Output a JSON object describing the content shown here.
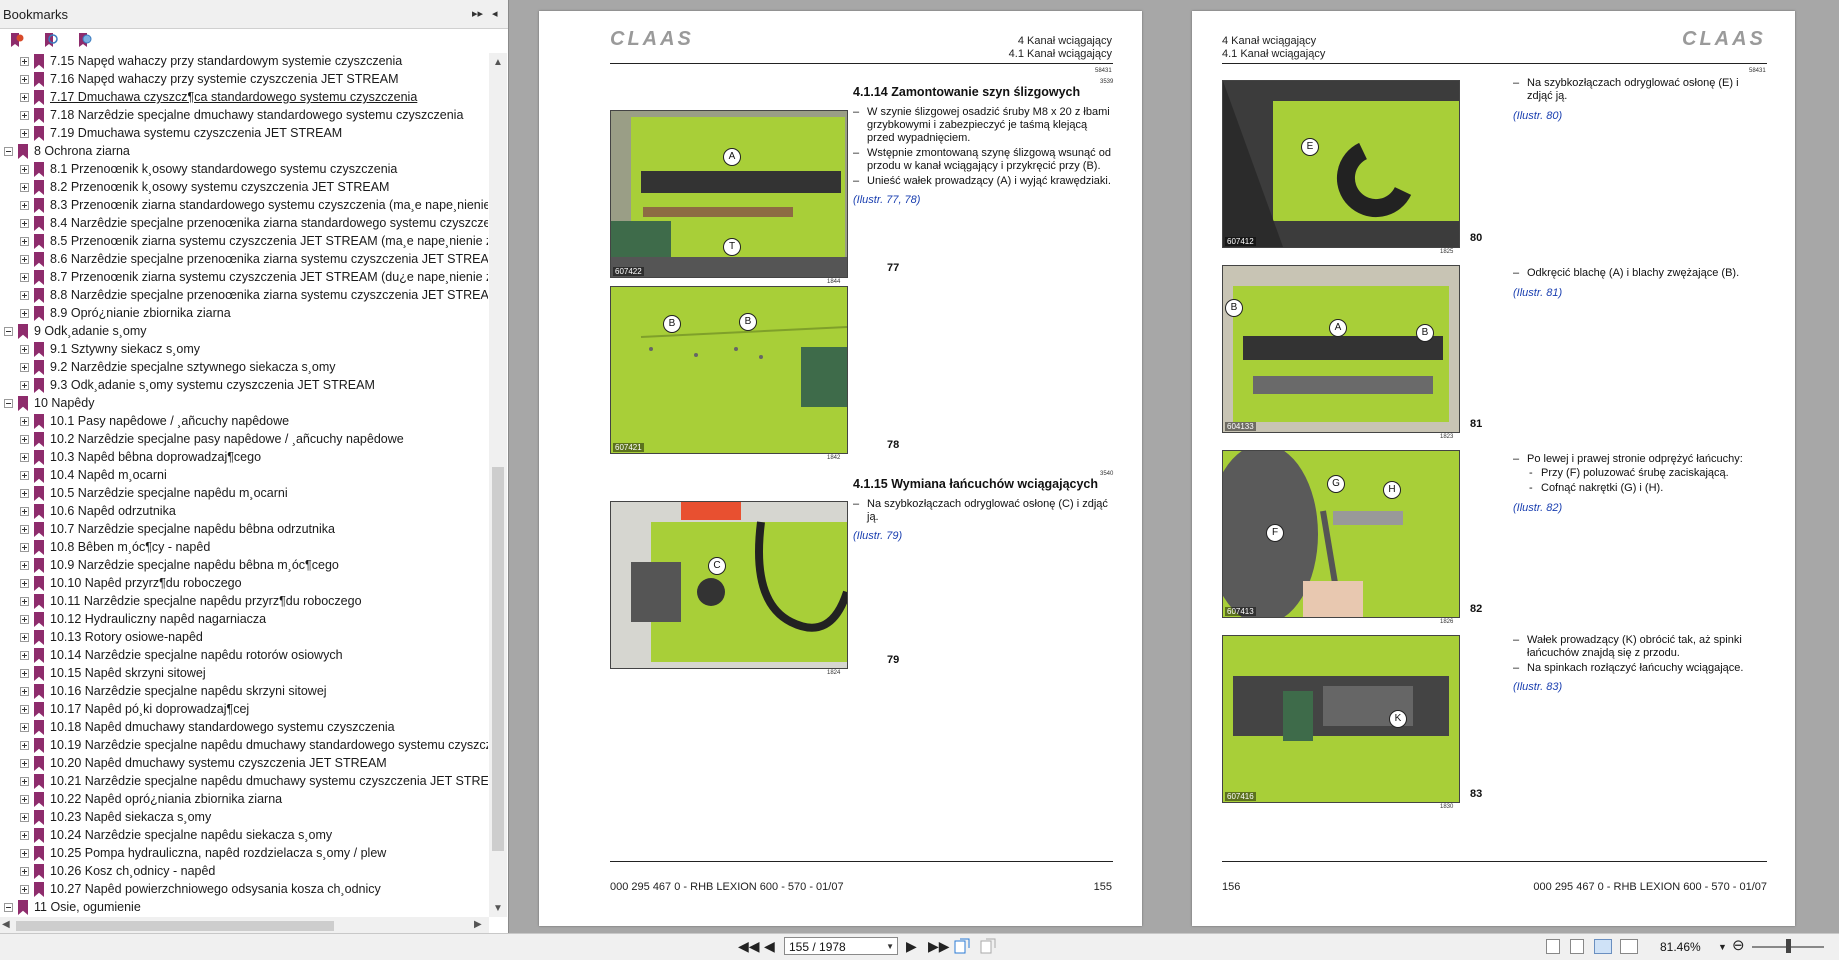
{
  "sidebar": {
    "title": "Bookmarks",
    "header_buttons": [
      "▸▸",
      "◂"
    ],
    "tools": [
      "bookmark-options-icon",
      "expand-bookmark-icon",
      "find-bookmark-icon"
    ],
    "items": [
      {
        "level": 1,
        "label": "7.15 Napęd wahaczy przy standardowym systemie czyszczenia"
      },
      {
        "level": 1,
        "label": "7.16 Napęd wahaczy przy systemie czyszczenia JET STREAM"
      },
      {
        "level": 1,
        "label": "7.17 Dmuchawa czyszcz¶ca standardowego systemu czyszczenia",
        "highlight": true
      },
      {
        "level": 1,
        "label": "7.18 Narzêdzie specjalne dmuchawy standardowego systemu czyszczenia"
      },
      {
        "level": 1,
        "label": "7.19 Dmuchawa systemu czyszczenia JET STREAM"
      },
      {
        "level": 0,
        "label": "8 Ochrona ziarna"
      },
      {
        "level": 1,
        "label": "8.1 Przenoœnik k¸osowy standardowego systemu czyszczenia"
      },
      {
        "level": 1,
        "label": "8.2 Przenoœnik k¸osowy systemu czyszczenia JET STREAM"
      },
      {
        "level": 1,
        "label": "8.3 Przenoœnik ziarna standardowego systemu czyszczenia (ma¸e nape¸nienie"
      },
      {
        "level": 1,
        "label": "8.4 Narzêdzie specjalne przenoœnika ziarna standardowego systemu czyszczen"
      },
      {
        "level": 1,
        "label": "8.5 Przenoœnik ziarna systemu czyszczenia JET STREAM (ma¸e nape¸nienie zb"
      },
      {
        "level": 1,
        "label": "8.6 Narzêdzie specjalne przenoœnika ziarna systemu czyszczenia JET STREAM ("
      },
      {
        "level": 1,
        "label": "8.7 Przenoœnik ziarna systemu czyszczenia JET STREAM (du¿e nape¸nienie zb"
      },
      {
        "level": 1,
        "label": "8.8 Narzêdzie specjalne przenoœnika ziarna systemu czyszczenia JET STREAM ("
      },
      {
        "level": 1,
        "label": "8.9 Opró¿nianie zbiornika ziarna"
      },
      {
        "level": 0,
        "label": "9 Odk¸adanie s¸omy"
      },
      {
        "level": 1,
        "label": "9.1 Sztywny siekacz s¸omy"
      },
      {
        "level": 1,
        "label": "9.2 Narzêdzie specjalne sztywnego siekacza s¸omy"
      },
      {
        "level": 1,
        "label": "9.3 Odk¸adanie s¸omy systemu czyszczenia JET STREAM"
      },
      {
        "level": 0,
        "label": "10 Napêdy"
      },
      {
        "level": 1,
        "label": "10.1 Pasy napêdowe / ¸añcuchy napêdowe"
      },
      {
        "level": 1,
        "label": "10.2 Narzêdzie specjalne pasy napêdowe / ¸añcuchy napêdowe"
      },
      {
        "level": 1,
        "label": "10.3 Napêd bêbna doprowadzaj¶cego"
      },
      {
        "level": 1,
        "label": "10.4 Napêd m¸ocarni"
      },
      {
        "level": 1,
        "label": "10.5 Narzêdzie specjalne napêdu m¸ocarni"
      },
      {
        "level": 1,
        "label": "10.6 Napêd odrzutnika"
      },
      {
        "level": 1,
        "label": "10.7 Narzêdzie specjalne napêdu bêbna odrzutnika"
      },
      {
        "level": 1,
        "label": "10.8 Bêben m¸óc¶cy - napêd"
      },
      {
        "level": 1,
        "label": "10.9 Narzêdzie specjalne napêdu bêbna m¸óc¶cego"
      },
      {
        "level": 1,
        "label": "10.10 Napêd przyrz¶du roboczego"
      },
      {
        "level": 1,
        "label": "10.11 Narzêdzie specjalne napêdu przyrz¶du roboczego"
      },
      {
        "level": 1,
        "label": "10.12 Hydrauliczny napêd nagarniacza"
      },
      {
        "level": 1,
        "label": "10.13 Rotory osiowe-napêd"
      },
      {
        "level": 1,
        "label": "10.14 Narzêdzie specjalne napêdu rotorów osiowych"
      },
      {
        "level": 1,
        "label": "10.15 Napêd skrzyni sitowej"
      },
      {
        "level": 1,
        "label": "10.16 Narzêdzie specjalne napêdu skrzyni sitowej"
      },
      {
        "level": 1,
        "label": "10.17 Napêd pó¸ki doprowadzaj¶cej"
      },
      {
        "level": 1,
        "label": "10.18 Napêd dmuchawy standardowego systemu czyszczenia"
      },
      {
        "level": 1,
        "label": "10.19 Narzêdzie specjalne napêdu dmuchawy standardowego systemu czyszcz"
      },
      {
        "level": 1,
        "label": "10.20 Napêd dmuchawy systemu czyszczenia JET STREAM"
      },
      {
        "level": 1,
        "label": "10.21 Narzêdzie specjalne napêdu dmuchawy systemu czyszczenia JET STREA"
      },
      {
        "level": 1,
        "label": "10.22 Napêd opró¿niania zbiornika ziarna"
      },
      {
        "level": 1,
        "label": "10.23 Napêd siekacza s¸omy"
      },
      {
        "level": 1,
        "label": "10.24 Narzêdzie specjalne napêdu siekacza s¸omy"
      },
      {
        "level": 1,
        "label": "10.25 Pompa hydrauliczna, napêd rozdzielacza s¸omy / plew"
      },
      {
        "level": 1,
        "label": "10.26 Kosz ch¸odnicy - napêd"
      },
      {
        "level": 1,
        "label": "10.27 Napêd powierzchniowego odsysania kosza ch¸odnicy"
      },
      {
        "level": 0,
        "label": "11 Osie, ogumienie"
      }
    ]
  },
  "left_page": {
    "logo": "CLAAS",
    "header_line1": "4 Kanał wciągający",
    "header_line2": "4.1 Kanał wciągający",
    "code_top": "58431",
    "section1": {
      "code": "3539",
      "title": "4.1.14 Zamontowanie szyn ślizgowych",
      "bullets": [
        "W szynie ślizgowej osadzić śruby M8 x 20 z łbami grzybkowymi i zabezpieczyć je taśmą klejącą przed wypadnięciem.",
        "Wstępnie zmontowaną szynę ślizgową wsunąć od przodu w kanał wciągający i przykręcić przy (B).",
        "Unieść wałek prowadzący (A) i wyjąć krawędziaki."
      ],
      "ref": "(Ilustr. 77, 78)"
    },
    "section2": {
      "code": "3540",
      "title": "4.1.15 Wymiana łańcuchów wciągających",
      "bullets": [
        "Na szybkozłączach odryglować osłonę (C) i zdjąć ją."
      ],
      "ref": "(Ilustr. 79)"
    },
    "figures": [
      {
        "num": "77",
        "id": "607422",
        "small": "1844",
        "callouts": [
          "A",
          "T"
        ]
      },
      {
        "num": "78",
        "id": "607421",
        "small": "1842",
        "callouts": [
          "B",
          "B"
        ]
      },
      {
        "num": "79",
        "id": "",
        "small": "1824",
        "callouts": [
          "C"
        ]
      }
    ],
    "footer_left": "000 295 467 0 - RHB LEXION 600 - 570 - 01/07",
    "footer_right": "155"
  },
  "right_page": {
    "logo": "CLAAS",
    "header_line1": "4 Kanał wciągający",
    "header_line2": "4.1 Kanał wciągający",
    "code_top": "58431",
    "blocks": [
      {
        "bullets": [
          "Na szybkozłączach odryglować osłonę (E) i zdjąć ją."
        ],
        "subs": [],
        "ref": "(Ilustr. 80)"
      },
      {
        "bullets": [
          "Odkręcić blachę (A) i blachy zwężające (B)."
        ],
        "subs": [],
        "ref": "(Ilustr. 81)"
      },
      {
        "bullets": [
          "Po lewej i prawej stronie odprężyć łańcuchy:"
        ],
        "subs": [
          "Przy (F) poluzować śrubę zaciskającą.",
          "Cofnąć nakrętki (G) i (H)."
        ],
        "ref": "(Ilustr. 82)"
      },
      {
        "bullets": [
          "Wałek prowadzący (K) obrócić tak, aż spinki łańcuchów znajdą się z przodu.",
          "Na spinkach rozłączyć łańcuchy wciągające."
        ],
        "subs": [],
        "ref": "(Ilustr. 83)"
      }
    ],
    "figures": [
      {
        "num": "80",
        "id": "607412",
        "small": "1825",
        "callouts": [
          "E"
        ]
      },
      {
        "num": "81",
        "id": "604133",
        "small": "1823",
        "callouts": [
          "A",
          "B",
          "B"
        ]
      },
      {
        "num": "82",
        "id": "607413",
        "small": "1826",
        "callouts": [
          "G",
          "H",
          "F"
        ]
      },
      {
        "num": "83",
        "id": "607416",
        "small": "1830",
        "callouts": [
          "K"
        ]
      }
    ],
    "footer_left": "156",
    "footer_right": "000 295 467 0 - RHB LEXION 600 - 570 - 01/07"
  },
  "toolbar": {
    "page_value": "155 / 1978",
    "zoom": "81.46%"
  },
  "colors": {
    "bookmark": "#8e2c6c",
    "link": "#1a3fb0",
    "machine_green": "#a8cf38"
  }
}
